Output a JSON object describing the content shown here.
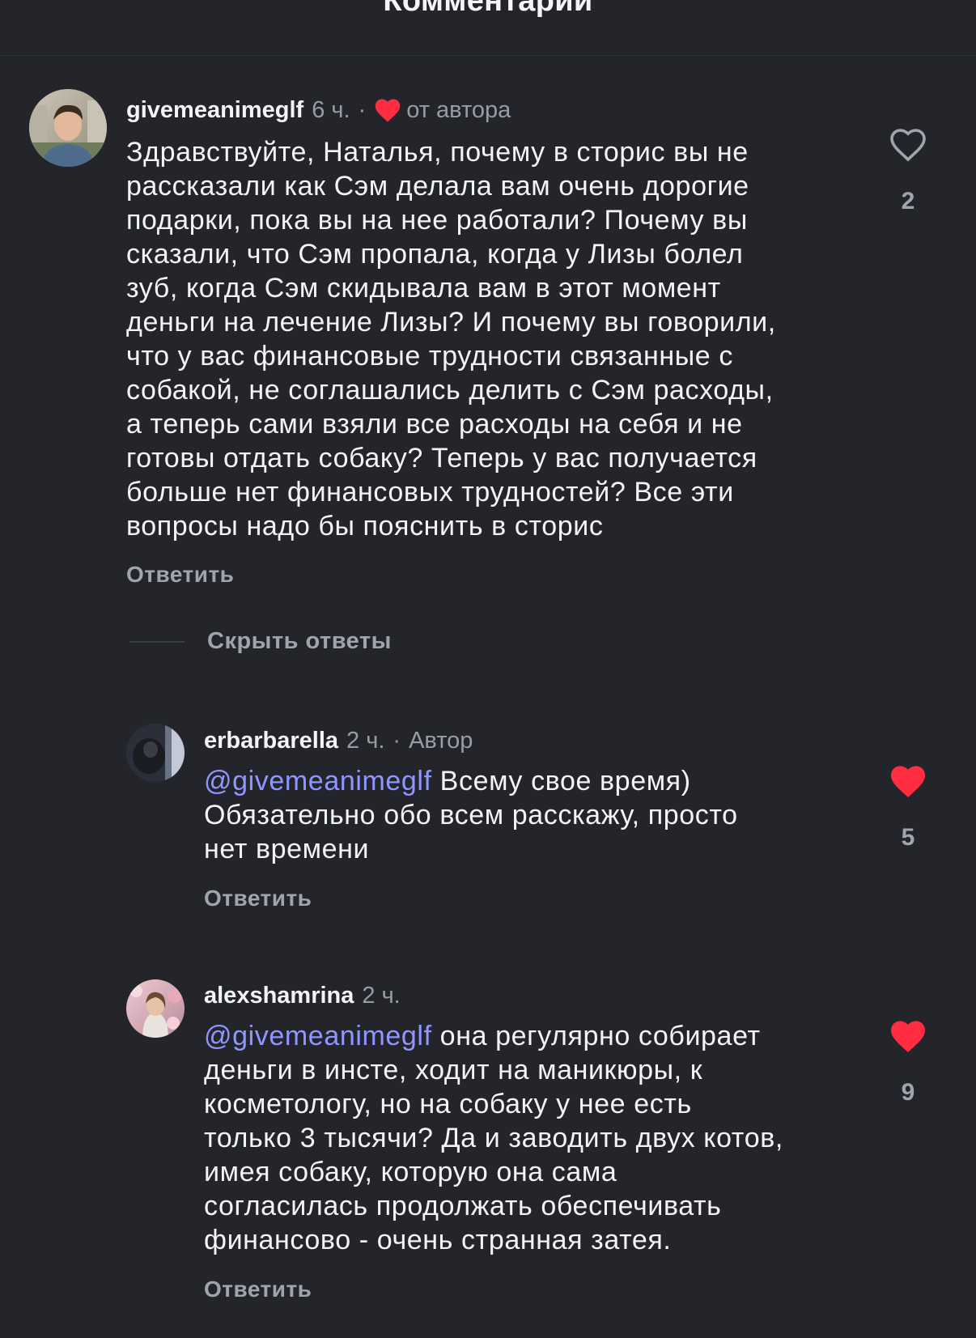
{
  "header": {
    "title": "Комментарии"
  },
  "comments": [
    {
      "username": "givemeanimeglf",
      "time": "6 ч.",
      "separator": "·",
      "author_badge": "от автора",
      "text": "Здравствуйте, Наталья, почему в сторис вы не\nрассказали как Сэм делала вам очень дорогие\nподарки, пока вы на нее работали? Почему вы\nсказали, что Сэм пропала, когда у Лизы болел\nзуб, когда Сэм скидывала вам в этот момент\nденьги на лечение Лизы? И почему вы говорили,\nчто у вас финансовые трудности связанные с\nсобакой, не соглашались делить с Сэм расходы,\nа теперь сами взяли все расходы на себя и не\nготовы отдать собаку? Теперь у вас получается\nбольше нет финансовых трудностей? Все эти\nвопросы надо бы пояснить в сторис",
      "reply_label": "Ответить",
      "likes": "2",
      "liked": false,
      "hide_replies_label": "Скрыть ответы"
    },
    {
      "username": "erbarbarella",
      "time": "2 ч.",
      "separator": "·",
      "author_badge": "Автор",
      "mention": "@givemeanimeglf",
      "text": " Всему свое время)\nОбязательно обо всем расскажу, просто\nнет времени",
      "reply_label": "Ответить",
      "likes": "5",
      "liked": true
    },
    {
      "username": "alexshamrina",
      "time": "2 ч.",
      "mention": "@givemeanimeglf",
      "text": " она регулярно собирает\nденьги в инсте, ходит на маникюры, к\nкосметологу, но на собаку у нее есть\nтолько 3 тысячи? Да и заводить двух котов,\nимея собаку, которую она сама\nсогласилась продолжать обеспечивать\nфинансово - очень странная затея.",
      "reply_label": "Ответить",
      "likes": "9",
      "liked": true
    }
  ],
  "colors": {
    "background": "#23252b",
    "text": "#f3f4f6",
    "muted": "#9a9ca3",
    "mention": "#8f96ff",
    "heart_red": "#ff2d3f"
  },
  "icons": {
    "like_outline": "heart-outline-icon",
    "like_filled": "heart-filled-icon",
    "creator_heart": "heart-filled-icon"
  }
}
